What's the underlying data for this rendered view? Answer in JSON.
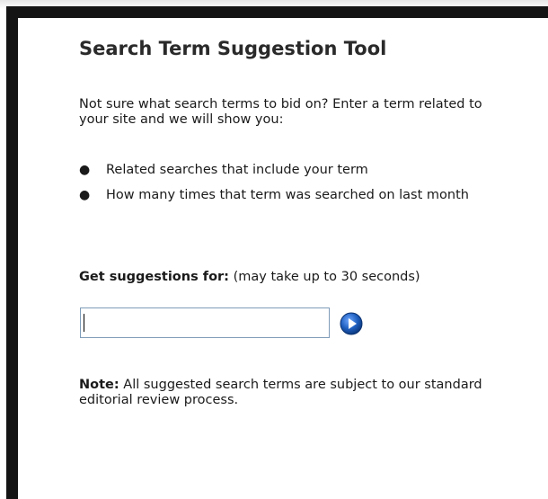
{
  "tool": {
    "title": "Search Term Suggestion Tool",
    "intro": "Not sure what search terms to bid on? Enter a term related to your site and we will show you:",
    "bullets": [
      "Related searches that include your term",
      "How many times that term was searched on last month"
    ],
    "bullet_glyph": "●"
  },
  "suggest": {
    "label_bold": "Get suggestions for:",
    "label_note": " (may take up to 30 seconds)",
    "input_value": "",
    "go_icon": "arrow-right-circle-icon",
    "go_color": "#1f5fbf"
  },
  "note": {
    "label_bold": "Note:",
    "text": " All suggested search terms are subject to our standard editorial review process."
  }
}
